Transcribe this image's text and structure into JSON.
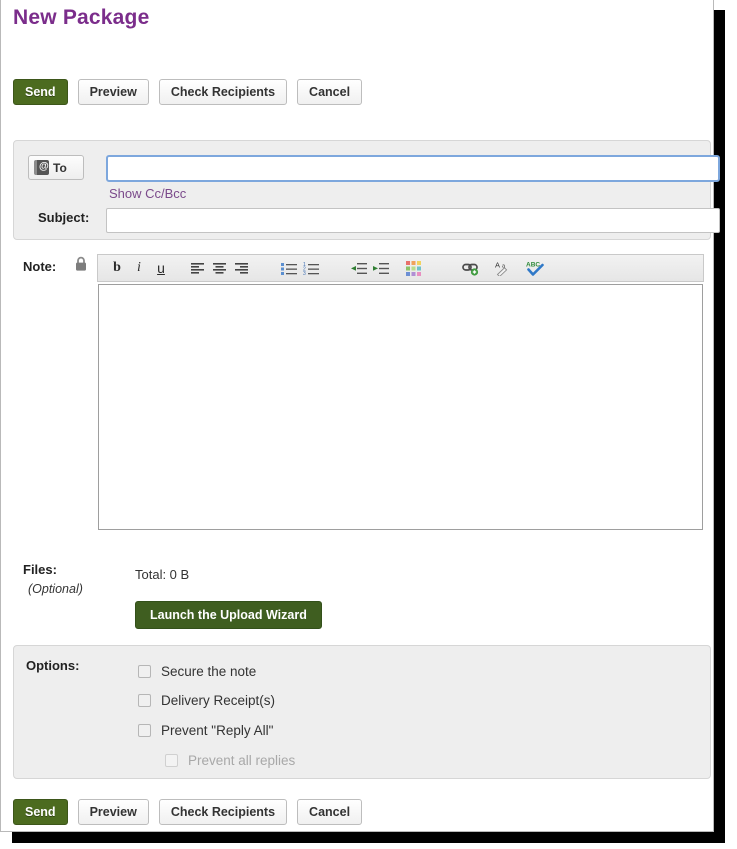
{
  "page": {
    "title": "New Package"
  },
  "actions": {
    "send": "Send",
    "preview": "Preview",
    "check_recipients": "Check Recipients",
    "cancel": "Cancel"
  },
  "recipients": {
    "to_button_label": "To",
    "to_icon": "address-book-icon",
    "to_value": "",
    "to_placeholder": "",
    "show_cc_bcc_link": "Show Cc/Bcc",
    "subject_label": "Subject:",
    "subject_value": "",
    "subject_placeholder": ""
  },
  "note": {
    "label": "Note:",
    "lock_icon": "padlock-icon",
    "body_value": "",
    "toolbar": [
      {
        "name": "bold-icon",
        "glyph": "b",
        "title": "Bold"
      },
      {
        "name": "italic-icon",
        "glyph": "i",
        "title": "Italic"
      },
      {
        "name": "underline-icon",
        "glyph": "u",
        "title": "Underline"
      },
      {
        "name": "align-left-icon",
        "glyph": "",
        "title": "Align left"
      },
      {
        "name": "align-center-icon",
        "glyph": "",
        "title": "Align center"
      },
      {
        "name": "align-right-icon",
        "glyph": "",
        "title": "Align right"
      },
      {
        "name": "bullet-list-icon",
        "glyph": "",
        "title": "Bulleted list"
      },
      {
        "name": "numbered-list-icon",
        "glyph": "",
        "title": "Numbered list"
      },
      {
        "name": "outdent-icon",
        "glyph": "",
        "title": "Decrease indent"
      },
      {
        "name": "indent-icon",
        "glyph": "",
        "title": "Increase indent"
      },
      {
        "name": "color-palette-icon",
        "glyph": "",
        "title": "Text color"
      },
      {
        "name": "insert-link-icon",
        "glyph": "",
        "title": "Insert link"
      },
      {
        "name": "font-format-icon",
        "glyph": "Aa",
        "title": "Font"
      },
      {
        "name": "spellcheck-icon",
        "glyph": "ABC",
        "title": "Spell check"
      }
    ]
  },
  "files": {
    "label": "Files:",
    "optional": "(Optional)",
    "total": "Total: 0 B",
    "wizard_button": "Launch the Upload Wizard"
  },
  "options": {
    "label": "Options:",
    "items": [
      {
        "label": "Secure the note",
        "checked": false,
        "disabled": false
      },
      {
        "label": "Delivery Receipt(s)",
        "checked": false,
        "disabled": false
      },
      {
        "label": "Prevent \"Reply All\"",
        "checked": false,
        "disabled": false
      },
      {
        "label": "Prevent all replies",
        "checked": false,
        "disabled": true
      }
    ]
  },
  "colors": {
    "title": "#7b2d8b",
    "link": "#7b4a8b",
    "primary_button": "#4c6b1f",
    "wizard_button": "#3f5e20",
    "panel_bg": "#eeeeee",
    "focus_border": "#7da7dd"
  }
}
